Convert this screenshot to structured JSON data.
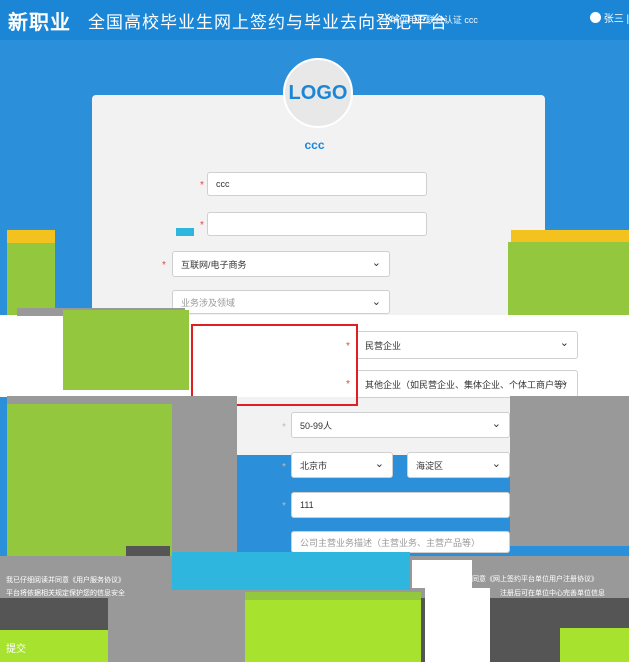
{
  "header": {
    "logo_text": "新职业",
    "title": "全国高校毕业生网上签约与毕业去向登记平台",
    "subtitle": "| 单位用户联合认证  ccc",
    "user": "张三 | 退"
  },
  "avatar": {
    "logo": "LOGO"
  },
  "company_name": "ccc",
  "form": {
    "company_name_value": "ccc",
    "industry_value": "互联网/电子商务",
    "business_placeholder": "业务涉及领域",
    "ownership_value": "民营企业",
    "ownership_sub_value": "其他企业（如民营企业、集体企业、个体工商户等）",
    "size_value": "50-99人",
    "province_value": "北京市",
    "district_value": "海淀区",
    "address_value": "111",
    "hint_value": "公司主营业务描述（主营业务、主营产品等）"
  },
  "bottom": {
    "submit_label": "提交",
    "left_notes": [
      "我已仔细阅读并同意《用户服务协议》",
      "平台将依据相关规定保护您的信息安全"
    ],
    "right_notes": [
      "我已阅读并同意《网上签约平台单位用户注册协议》",
      "注册后可在单位中心完善单位信息"
    ]
  }
}
